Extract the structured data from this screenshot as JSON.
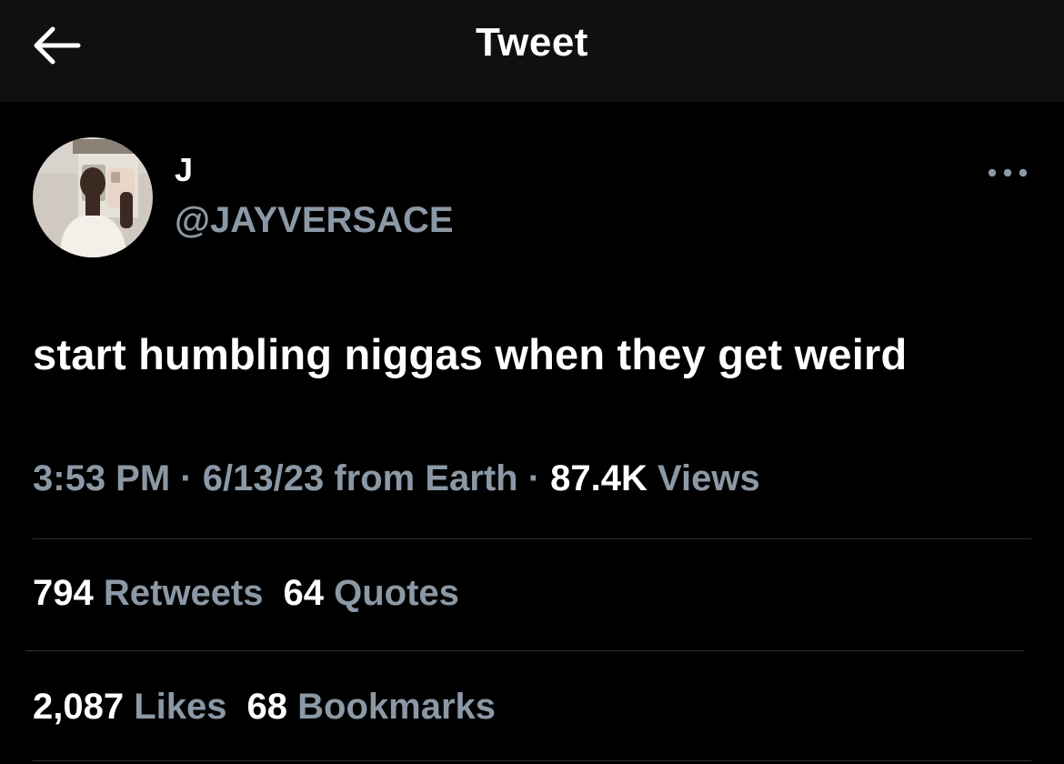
{
  "header": {
    "title": "Tweet",
    "back_icon": "arrow-left-icon"
  },
  "author": {
    "display_name": "J",
    "handle": "@JAYVERSACE",
    "avatar_icon": "profile-photo-avatar"
  },
  "more_icon": "more-horizontal-icon",
  "tweet": {
    "text": "start humbling niggas when they get weird"
  },
  "meta": {
    "time": "3:53 PM",
    "sep1": "·",
    "date": "6/13/23",
    "source": "from Earth",
    "sep2": "·",
    "views_count": "87.4K",
    "views_label": "Views"
  },
  "stats": {
    "retweets_count": "794",
    "retweets_label": "Retweets",
    "quotes_count": "64",
    "quotes_label": "Quotes",
    "likes_count": "2,087",
    "likes_label": "Likes",
    "bookmarks_count": "68",
    "bookmarks_label": "Bookmarks"
  },
  "colors": {
    "background": "#000000",
    "header_background": "#101010",
    "primary_text": "#ffffff",
    "secondary_text": "#8b98a5",
    "divider": "#2f3336"
  }
}
